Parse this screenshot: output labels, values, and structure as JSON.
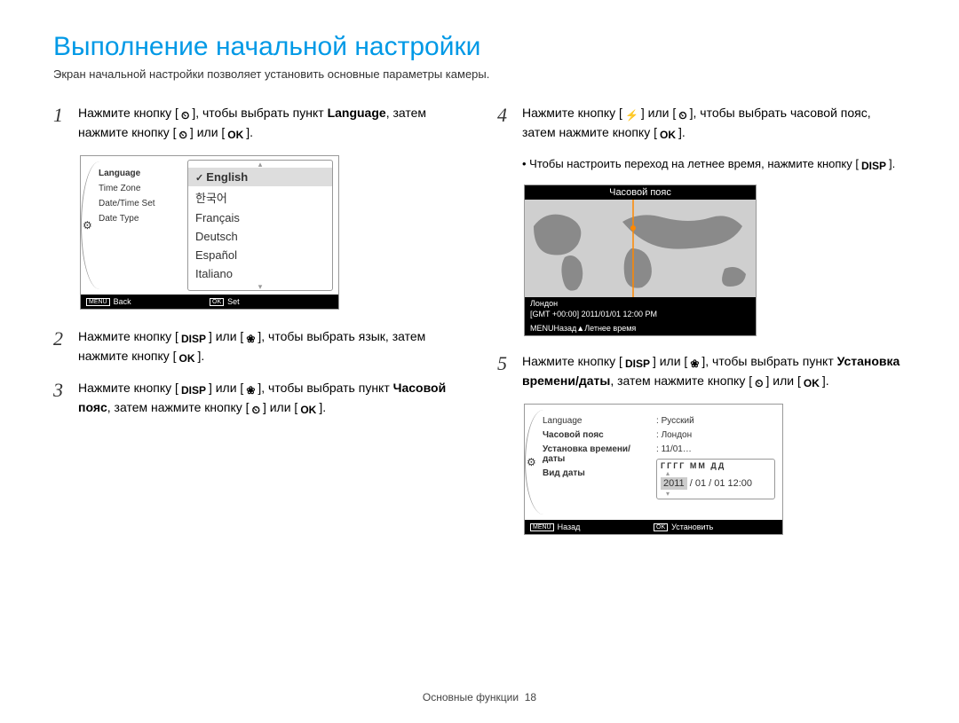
{
  "title": "Выполнение начальной настройки",
  "subtitle": "Экран начальной настройки позволяет установить основные параметры камеры.",
  "icons": {
    "timer": "⏲",
    "ok": "OK",
    "disp": "DISP",
    "flower": "❀",
    "flash": "⚡"
  },
  "steps": {
    "s1": {
      "n": "1",
      "t1": "Нажмите кнопку [",
      "t2": "], чтобы выбрать пункт ",
      "b": "Language",
      "t3": ", затем нажмите кнопку [",
      "t4": "] или [",
      "t5": "]."
    },
    "s2": {
      "n": "2",
      "t1": "Нажмите кнопку [",
      "t2": "] или [",
      "t3": "], чтобы выбрать язык, затем нажмите кнопку [",
      "t4": "]."
    },
    "s3": {
      "n": "3",
      "t1": "Нажмите кнопку [",
      "t2": "] или [",
      "t3": "], чтобы выбрать пункт ",
      "b": "Часовой пояс",
      "t4": ", затем нажмите кнопку [",
      "t5": "] или [",
      "t6": "]."
    },
    "s4": {
      "n": "4",
      "t1": "Нажмите кнопку [",
      "t2": "] или [",
      "t3": "], чтобы выбрать часовой пояс, затем нажмите кнопку [",
      "t4": "]."
    },
    "s4b": {
      "t1": "Чтобы настроить переход на летнее время, нажмите кнопку [",
      "t2": "]."
    },
    "s5": {
      "n": "5",
      "t1": "Нажмите кнопку [",
      "t2": "] или [",
      "t3": "], чтобы выбрать пункт ",
      "b": "Установка времени/даты",
      "t4": ", затем нажмите кнопку [",
      "t5": "] или [",
      "t6": "]."
    }
  },
  "lcd1": {
    "side": [
      "Language",
      "Time Zone",
      "Date/Time Set",
      "Date Type"
    ],
    "langs": [
      "English",
      "한국어",
      "Français",
      "Deutsch",
      "Español",
      "Italiano"
    ],
    "foot_back_box": "MENU",
    "foot_back": "Back",
    "foot_set_box": "OK",
    "foot_set": "Set"
  },
  "lcd2": {
    "title": "Часовой пояс",
    "city": "Лондон",
    "gmt": "[GMT +00:00] 2011/01/01 12:00 PM",
    "foot_back_box": "MENU",
    "foot_back": "Назад",
    "foot_dst": "Летнее время"
  },
  "lcd3": {
    "side": [
      {
        "t": "Language",
        "b": false
      },
      {
        "t": "Часовой пояс",
        "b": true
      },
      {
        "t": "Установка времени/даты",
        "b": true
      },
      {
        "t": "Вид даты",
        "b": true
      }
    ],
    "vals": [
      "Русский",
      "Лондон",
      "11/01…"
    ],
    "date_hdr": "ГГГГ ММ ДД",
    "date_row_sel": "2011",
    "date_row_rest": " / 01 / 01 12:00",
    "foot_back_box": "MENU",
    "foot_back": "Назад",
    "foot_set_box": "OK",
    "foot_set": "Установить"
  },
  "footer": {
    "section": "Основные функции",
    "page": "18"
  }
}
